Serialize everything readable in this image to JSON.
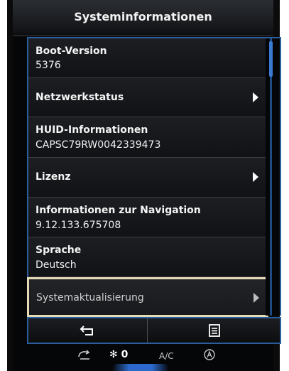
{
  "title": "Systeminformationen",
  "rows": [
    {
      "label": "Boot-Version",
      "value": "5376"
    },
    {
      "label": "Netzwerkstatus",
      "value": ""
    },
    {
      "label": "HUID-Informationen",
      "value": "CAPSC79RW0042339473"
    },
    {
      "label": "Lizenz",
      "value": ""
    },
    {
      "label": "Informationen zur Navigation",
      "value": "9.12.133.675708"
    },
    {
      "label": "Sprache",
      "value": "Deutsch"
    },
    {
      "label": "Systemaktualisierung",
      "value": ""
    }
  ],
  "softkeys": {
    "back_icon": "back-arrow-icon",
    "menu_icon": "list-menu-icon"
  },
  "status": {
    "fan_speed": "0",
    "ac_label": "A/C",
    "icons": [
      "recirculation-icon",
      "fan-icon",
      "auto-climate-icon"
    ]
  },
  "colors": {
    "frame_blue": "#2b5e9d",
    "highlight_border": "#e6dbb5",
    "background": "#050607"
  }
}
